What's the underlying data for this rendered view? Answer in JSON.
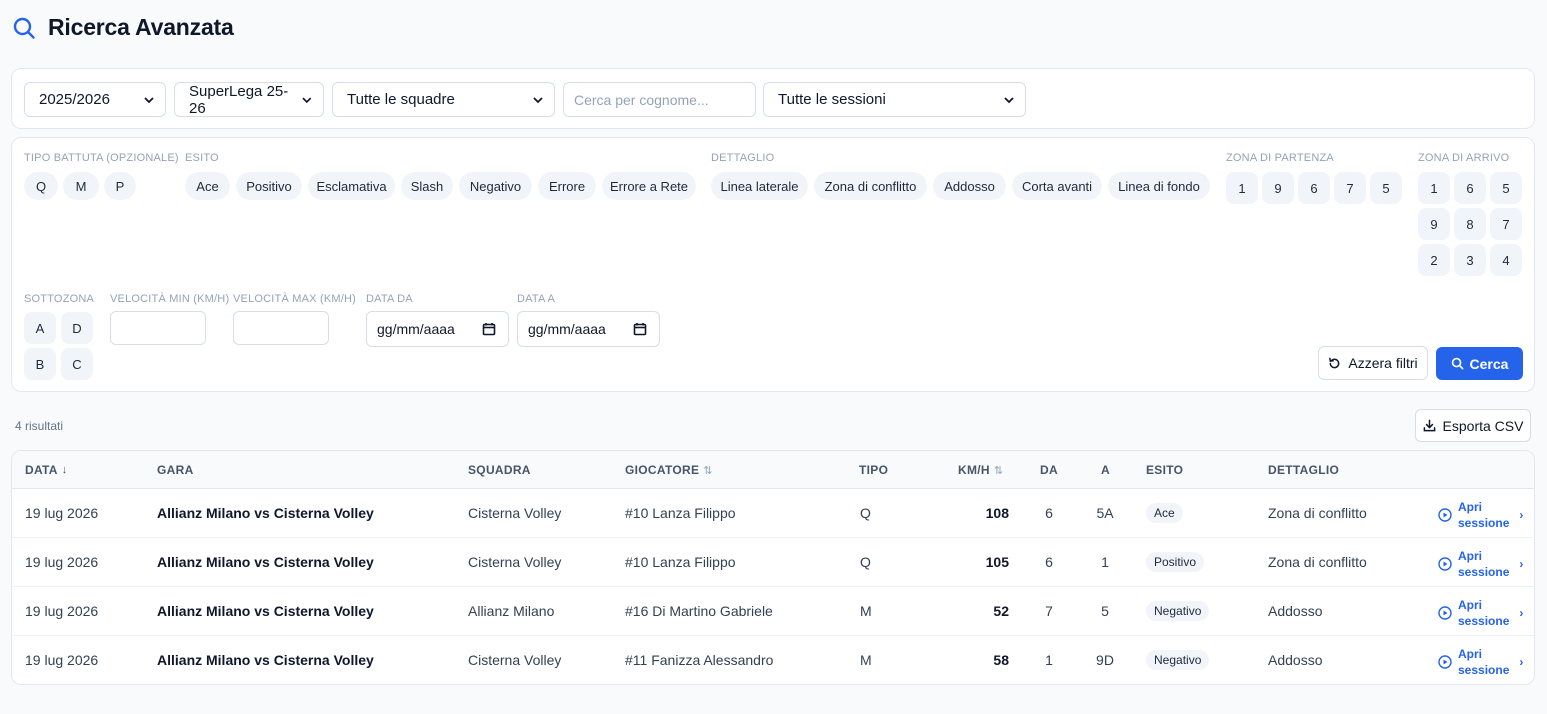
{
  "header": {
    "title": "Ricerca Avanzata"
  },
  "top_filters": {
    "season": "2025/2026",
    "league": "SuperLega 25-26",
    "team": "Tutte le squadre",
    "surname_placeholder": "Cerca per cognome...",
    "session": "Tutte le sessioni"
  },
  "filters": {
    "tipo_label": "TIPO BATTUTA (OPZIONALE)",
    "tipo": [
      "Q",
      "M",
      "P"
    ],
    "esito_label": "ESITO",
    "esito": [
      "Ace",
      "Positivo",
      "Esclamativa",
      "Slash",
      "Negativo",
      "Errore",
      "Errore a Rete"
    ],
    "dettaglio_label": "DETTAGLIO",
    "dettaglio": [
      "Linea laterale",
      "Zona di conflitto",
      "Addosso",
      "Corta avanti",
      "Linea di fondo"
    ],
    "partenza_label": "ZONA DI PARTENZA",
    "partenza": [
      "1",
      "9",
      "6",
      "7",
      "5"
    ],
    "arrivo_label": "ZONA DI ARRIVO",
    "arrivo": [
      "1",
      "6",
      "5",
      "9",
      "8",
      "7",
      "2",
      "3",
      "4"
    ],
    "sottozona_label": "SOTTOZONA",
    "sottozona": [
      "A",
      "D",
      "B",
      "C"
    ],
    "vel_min_label": "VELOCITÀ MIN (KM/H)",
    "vel_max_label": "VELOCITÀ MAX (KM/H)",
    "data_da_label": "DATA DA",
    "data_a_label": "DATA A",
    "date_placeholder": "gg/mm/aaaa",
    "reset_label": "Azzera filtri",
    "search_label": "Cerca"
  },
  "results": {
    "count_label": "4 risultati",
    "export_label": "Esporta CSV",
    "columns": {
      "data": "DATA",
      "gara": "GARA",
      "squadra": "SQUADRA",
      "giocatore": "GIOCATORE",
      "tipo": "TIPO",
      "kmh": "KM/H",
      "da": "DA",
      "a": "A",
      "esito": "ESITO",
      "dettaglio": "DETTAGLIO"
    },
    "sort_desc_glyph": "↓",
    "sort_glyph": "⇅",
    "open_label_1": "Apri",
    "open_label_2": "sessione",
    "rows": [
      {
        "data": "19 lug 2026",
        "gara": "Allianz Milano vs Cisterna Volley",
        "squadra": "Cisterna Volley",
        "giocatore": "#10 Lanza Filippo",
        "tipo": "Q",
        "kmh": "108",
        "da": "6",
        "a": "5A",
        "esito": "Ace",
        "dettaglio": "Zona di conflitto"
      },
      {
        "data": "19 lug 2026",
        "gara": "Allianz Milano vs Cisterna Volley",
        "squadra": "Cisterna Volley",
        "giocatore": "#10 Lanza Filippo",
        "tipo": "Q",
        "kmh": "105",
        "da": "6",
        "a": "1",
        "esito": "Positivo",
        "dettaglio": "Zona di conflitto"
      },
      {
        "data": "19 lug 2026",
        "gara": "Allianz Milano vs Cisterna Volley",
        "squadra": "Allianz Milano",
        "giocatore": "#16 Di Martino Gabriele",
        "tipo": "M",
        "kmh": "52",
        "da": "7",
        "a": "5",
        "esito": "Negativo",
        "dettaglio": "Addosso"
      },
      {
        "data": "19 lug 2026",
        "gara": "Allianz Milano vs Cisterna Volley",
        "squadra": "Cisterna Volley",
        "giocatore": "#11 Fanizza Alessandro",
        "tipo": "M",
        "kmh": "58",
        "da": "1",
        "a": "9D",
        "esito": "Negativo",
        "dettaglio": "Addosso"
      }
    ]
  },
  "colors": {
    "accent": "#2563eb",
    "chip_bg": "#f1f5f9",
    "border": "#e2e8f0"
  }
}
